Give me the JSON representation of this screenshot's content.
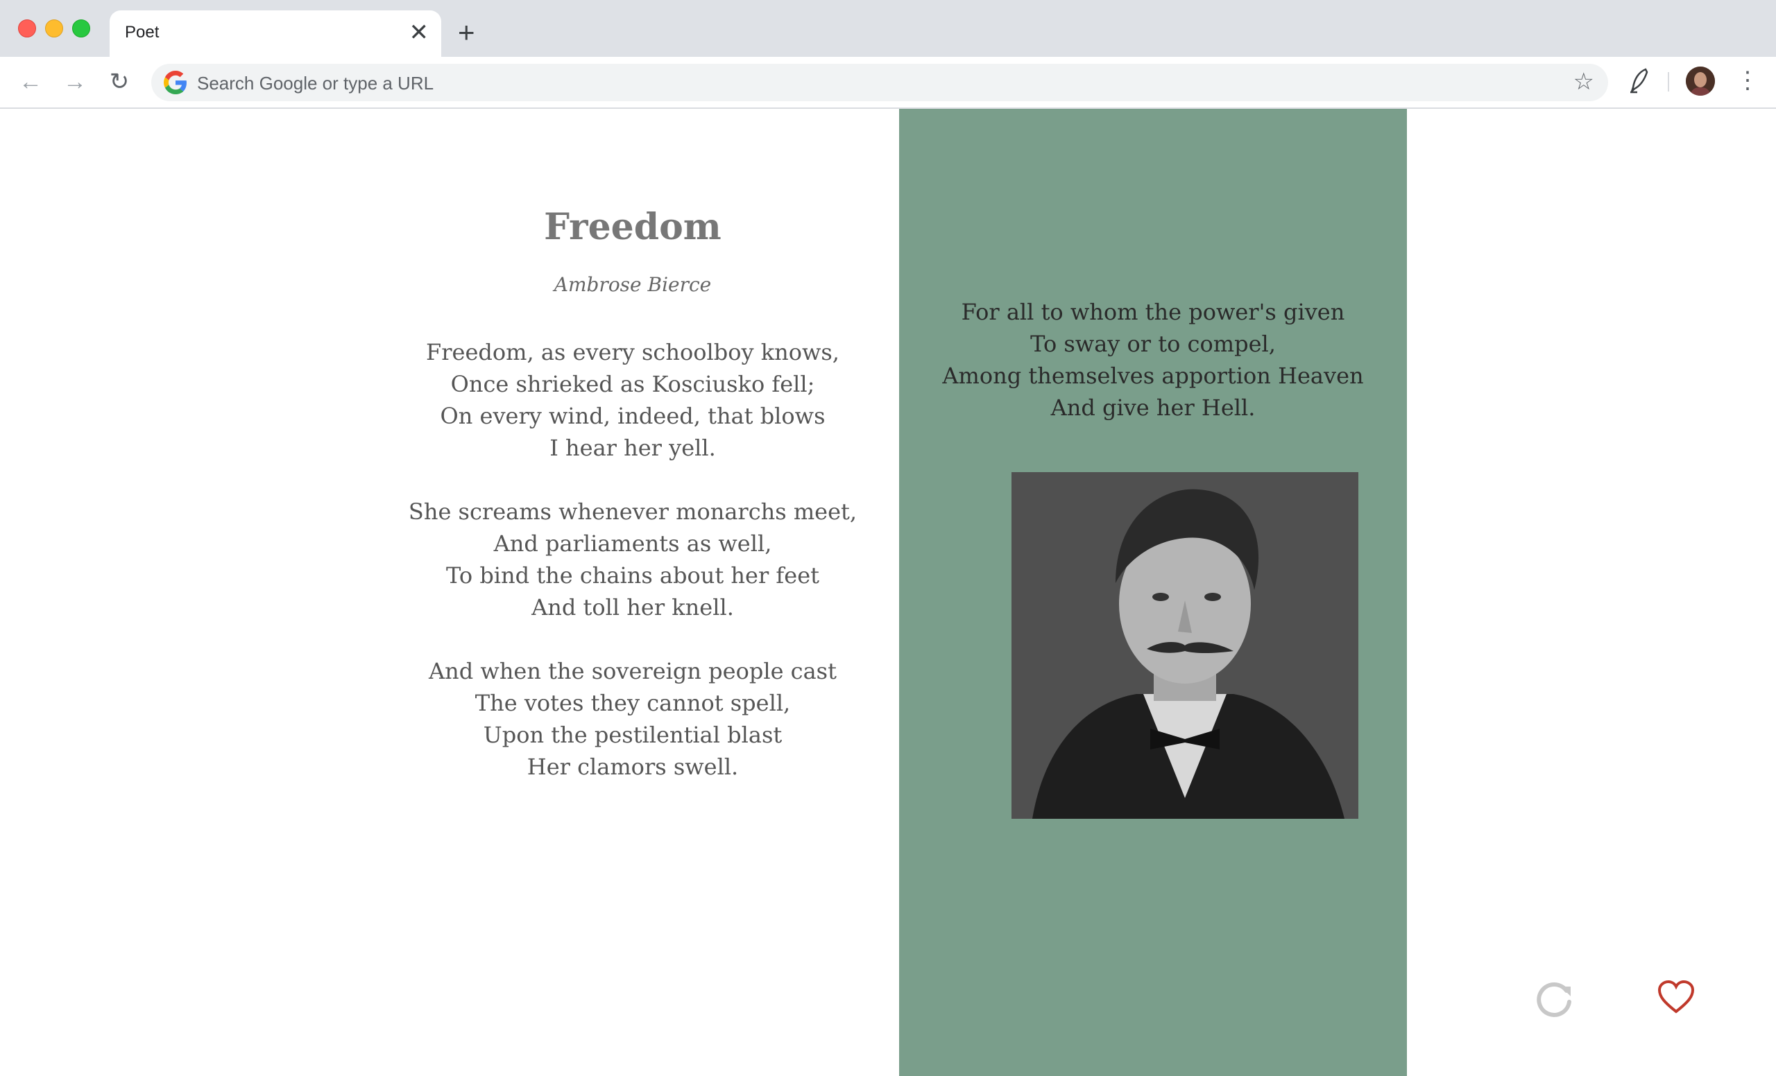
{
  "browser": {
    "tab_title": "Poet",
    "close_glyph": "✕",
    "newtab_glyph": "+",
    "omnibox_placeholder": "Search Google or type a URL",
    "back_glyph": "←",
    "forward_glyph": "→",
    "reload_glyph": "↻",
    "star_glyph": "☆",
    "menu_glyph": "⋮"
  },
  "poem": {
    "title": "Freedom",
    "author": "Ambrose Bierce",
    "stanzas": [
      [
        "Freedom, as every schoolboy knows,",
        "Once shrieked as Kosciusko fell;",
        "On every wind, indeed, that blows",
        "I hear her yell."
      ],
      [
        "She screams whenever monarchs meet,",
        "And parliaments as well,",
        "To bind the chains about her feet",
        "And toll her knell."
      ],
      [
        "And when the sovereign people cast",
        "The votes they cannot spell,",
        "Upon the pestilential blast",
        "Her clamors swell."
      ]
    ]
  },
  "side_panel": {
    "quote_lines": [
      "For all to whom the power's given",
      "To sway or to compel,",
      "Among themselves apportion Heaven",
      "And give her Hell."
    ],
    "portrait_icon": "author-portrait"
  },
  "colors": {
    "panel_green": "#7a9e8b",
    "heart_red": "#c0392b"
  },
  "icons": [
    "back-arrow-icon",
    "forward-arrow-icon",
    "reload-icon",
    "google-icon",
    "star-icon",
    "quill-extension-icon",
    "profile-avatar",
    "menu-dots-icon",
    "refresh-poem-icon",
    "heart-icon"
  ]
}
